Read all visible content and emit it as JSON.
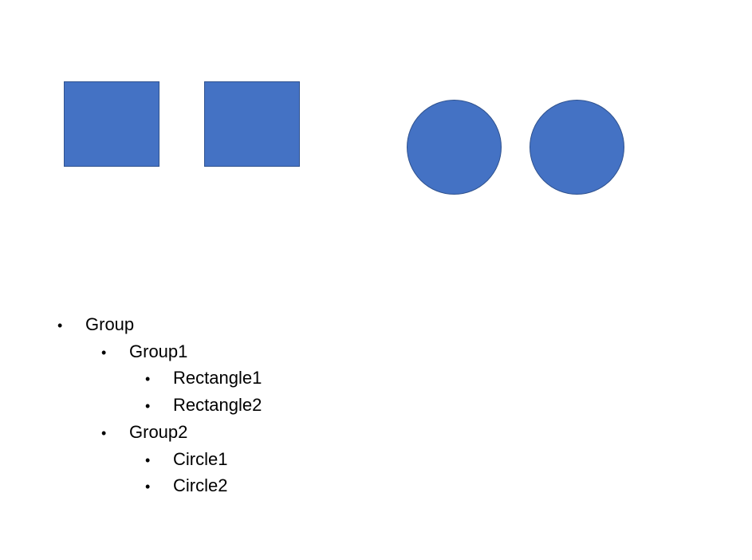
{
  "colors": {
    "shape_fill": "#4472c4",
    "shape_border": "#2f528f",
    "background": "#ffffff",
    "text": "#000000"
  },
  "shapes": [
    {
      "kind": "rectangle"
    },
    {
      "kind": "rectangle"
    },
    {
      "kind": "circle"
    },
    {
      "kind": "circle"
    }
  ],
  "outline": {
    "bullet_glyph": "•",
    "root": "Group",
    "group1": {
      "label": "Group1",
      "children": [
        "Rectangle1",
        "Rectangle2"
      ]
    },
    "group2": {
      "label": "Group2",
      "children": [
        "Circle1",
        "Circle2"
      ]
    }
  }
}
